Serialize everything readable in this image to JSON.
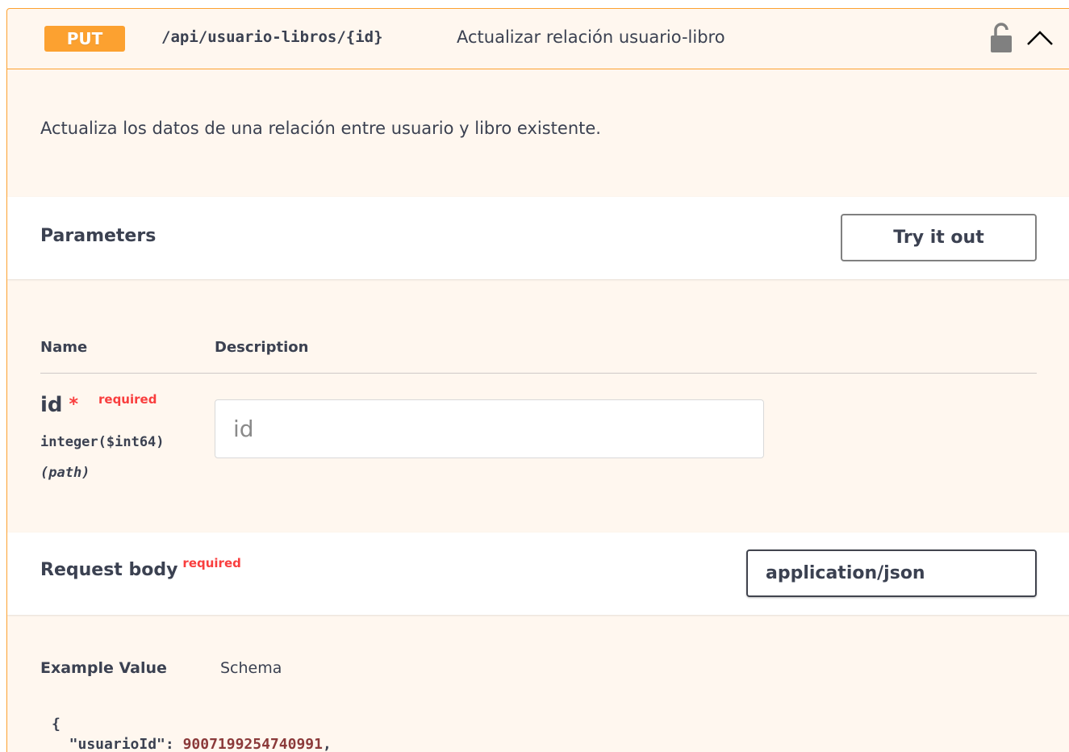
{
  "operation": {
    "method": "PUT",
    "path": "/api/usuario-libros/{id}",
    "summary": "Actualizar relación usuario-libro",
    "description": "Actualiza los datos de una relación entre usuario y libro existente.",
    "icons": {
      "lock": "unlocked-padlock-icon",
      "toggle": "chevron-up-icon"
    }
  },
  "parameters": {
    "title": "Parameters",
    "try_it_out_label": "Try it out",
    "col_name": "Name",
    "col_description": "Description",
    "items": [
      {
        "name": "id",
        "asterisk": "*",
        "required_label": "required",
        "type": "integer($int64)",
        "in": "(path)",
        "placeholder": "id"
      }
    ]
  },
  "request_body": {
    "title": "Request body",
    "required_label": "required",
    "content_type": "application/json"
  },
  "example": {
    "tab_example": "Example Value",
    "tab_schema": "Schema",
    "line1": "{",
    "line2_key": "  \"usuarioId\": ",
    "line2_value": "9007199254740991",
    "line2_tail": ","
  },
  "colors": {
    "put_accent": "#fca130",
    "block_background": "#fff7ef",
    "required": "#f93e3e",
    "text": "#3b4151"
  }
}
